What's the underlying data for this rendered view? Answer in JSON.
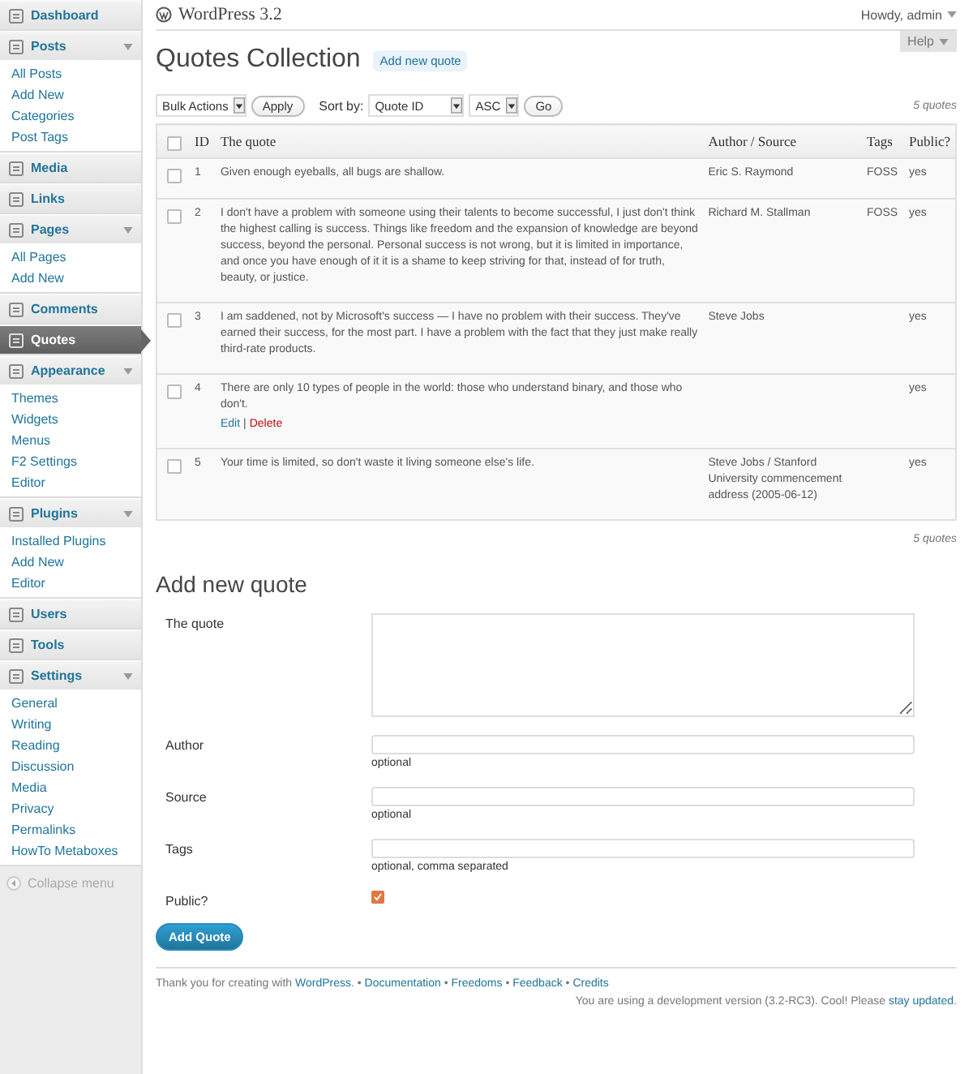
{
  "sidebar": {
    "items": [
      {
        "label": "Dashboard",
        "selected": false,
        "expanded": false
      },
      {
        "label": "Posts",
        "selected": false,
        "expanded": true,
        "children": [
          "All Posts",
          "Add New",
          "Categories",
          "Post Tags"
        ]
      },
      {
        "label": "Media",
        "selected": false,
        "expanded": false
      },
      {
        "label": "Links",
        "selected": false,
        "expanded": false
      },
      {
        "label": "Pages",
        "selected": false,
        "expanded": true,
        "children": [
          "All Pages",
          "Add New"
        ]
      },
      {
        "label": "Comments",
        "selected": false,
        "expanded": false
      },
      {
        "label": "Quotes",
        "selected": true,
        "expanded": false
      },
      {
        "label": "Appearance",
        "selected": false,
        "expanded": true,
        "children": [
          "Themes",
          "Widgets",
          "Menus",
          "F2 Settings",
          "Editor"
        ]
      },
      {
        "label": "Plugins",
        "selected": false,
        "expanded": true,
        "children": [
          "Installed Plugins",
          "Add New",
          "Editor"
        ]
      },
      {
        "label": "Users",
        "selected": false,
        "expanded": false
      },
      {
        "label": "Tools",
        "selected": false,
        "expanded": false
      },
      {
        "label": "Settings",
        "selected": false,
        "expanded": true,
        "children": [
          "General",
          "Writing",
          "Reading",
          "Discussion",
          "Media",
          "Privacy",
          "Permalinks",
          "HowTo Metaboxes"
        ]
      }
    ],
    "collapse": "Collapse menu"
  },
  "header": {
    "site": "WordPress 3.2",
    "user": "Howdy, admin",
    "help": "Help"
  },
  "page": {
    "title": "Quotes Collection",
    "add_button": "Add new quote"
  },
  "toolbar": {
    "bulk": "Bulk Actions",
    "apply": "Apply",
    "sort_label": "Sort by:",
    "sort_field": "Quote ID",
    "sort_order": "ASC",
    "go": "Go",
    "count": "5 quotes"
  },
  "table": {
    "columns": [
      "ID",
      "The quote",
      "Author / Source",
      "Tags",
      "Public?"
    ],
    "header_checked": false,
    "rows": [
      {
        "checked": false,
        "id": "1",
        "quote": "Given enough eyeballs, all bugs are shallow.",
        "author": "Eric S. Raymond",
        "tags": "FOSS",
        "public": "yes"
      },
      {
        "checked": false,
        "id": "2",
        "quote": "I don't have a problem with someone using their talents to become successful, I just don't think the highest calling is success. Things like freedom and the expansion of knowledge are beyond success, beyond the personal. Personal success is not wrong, but it is limited in importance, and once you have enough of it it is a shame to keep striving for that, instead of for truth, beauty, or justice.",
        "author": "Richard M. Stallman",
        "tags": "FOSS",
        "public": "yes"
      },
      {
        "checked": false,
        "id": "3",
        "quote": "I am saddened, not by Microsoft's success — I have no problem with their success. They've earned their success, for the most part. I have a problem with the fact that they just make really third-rate products.",
        "author": "Steve Jobs",
        "public": "yes"
      },
      {
        "checked": false,
        "id": "4",
        "quote": "There are only 10 types of people in the world: those who understand binary, and those who don't.",
        "public": "yes",
        "actions": [
          {
            "label": "Edit",
            "kind": "edit"
          },
          {
            "label": "Delete",
            "kind": "delete"
          }
        ],
        "action_separator": "|"
      },
      {
        "checked": false,
        "id": "5",
        "quote": "Your time is limited, so don't waste it living someone else's life.",
        "author": "Steve Jobs / Stanford University commencement address (2005-06-12)",
        "public": "yes"
      }
    ],
    "count": "5 quotes"
  },
  "form": {
    "title": "Add new quote",
    "fields": [
      {
        "kind": "textarea",
        "label": "The quote"
      },
      {
        "kind": "text",
        "label": "Author",
        "hint": "optional"
      },
      {
        "kind": "text",
        "label": "Source",
        "hint": "optional"
      },
      {
        "kind": "text",
        "label": "Tags",
        "hint": "optional, comma separated"
      },
      {
        "kind": "checkbox",
        "label": "Public?",
        "checked": true
      }
    ],
    "submit": "Add Quote"
  },
  "footer": {
    "left": [
      {
        "kind": "text",
        "text": "Thank you for creating with "
      },
      {
        "kind": "link",
        "text": "WordPress"
      },
      {
        "kind": "text",
        "text": ". • "
      },
      {
        "kind": "link",
        "text": "Documentation"
      },
      {
        "kind": "text",
        "text": " • "
      },
      {
        "kind": "link",
        "text": "Freedoms"
      },
      {
        "kind": "text",
        "text": " • "
      },
      {
        "kind": "link",
        "text": "Feedback"
      },
      {
        "kind": "text",
        "text": " • "
      },
      {
        "kind": "link",
        "text": "Credits"
      }
    ],
    "right": [
      {
        "kind": "text",
        "text": "You are using a development version (3.2-RC3). Cool! Please "
      },
      {
        "kind": "link",
        "text": "stay updated"
      },
      {
        "kind": "text",
        "text": "."
      }
    ]
  }
}
